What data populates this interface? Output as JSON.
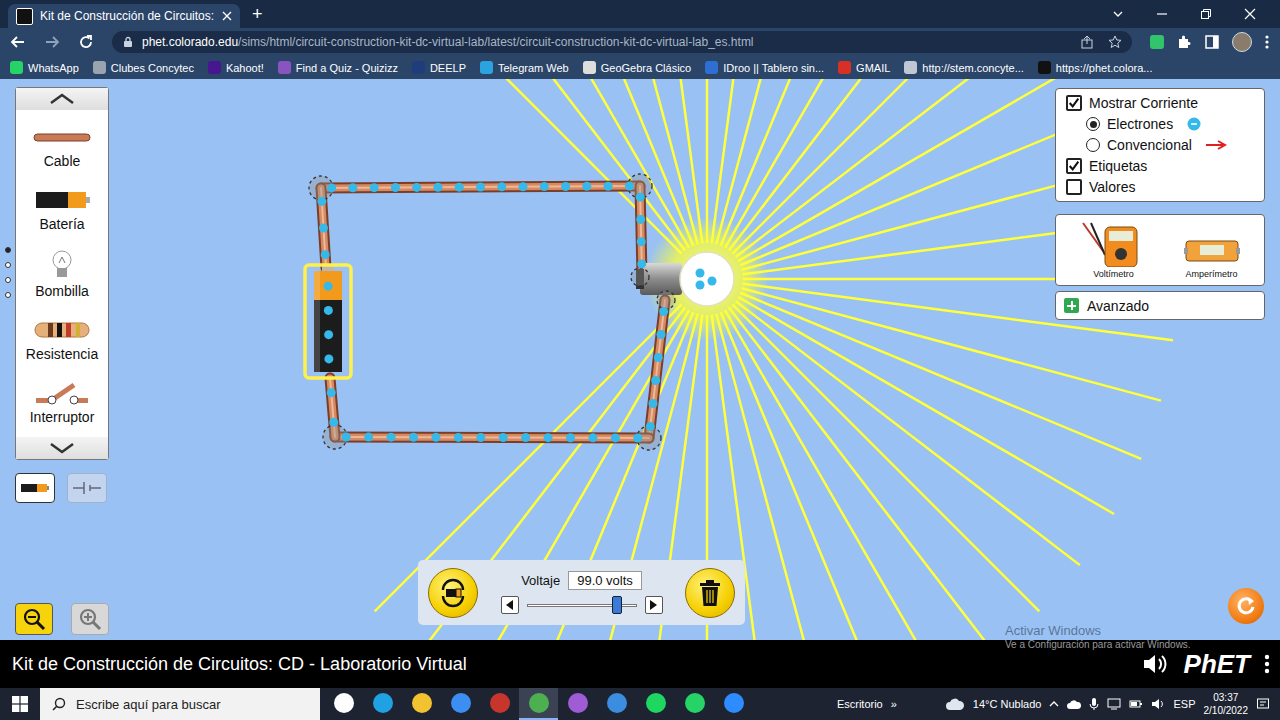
{
  "browser": {
    "tabs": [
      {
        "label": "Kit de Construcción de Circuitos:",
        "selected": true
      }
    ],
    "new_tab": "+",
    "url_host": "phet.colorado.edu",
    "url_path": "/sims/html/circuit-construction-kit-dc-virtual-lab/latest/circuit-construction-kit-dc-virtual-lab_es.html",
    "bookmarks": [
      "WhatsApp",
      "Clubes Concytec",
      "Kahoot!",
      "Find a Quiz - Quizizz",
      "DEELP",
      "Telegram Web",
      "GeoGebra Clásico",
      "IDroo || Tablero sin...",
      "GMAIL",
      "http://stem.concyte...",
      "https://phet.colora..."
    ]
  },
  "sim": {
    "palette": {
      "items": [
        {
          "label": "Cable",
          "kind": "wire"
        },
        {
          "label": "Batería",
          "kind": "battery"
        },
        {
          "label": "Bombilla",
          "kind": "bulb"
        },
        {
          "label": "Resistencia",
          "kind": "resistor"
        },
        {
          "label": "Interruptor",
          "kind": "switch"
        }
      ],
      "pages": [
        {
          "selected": true
        },
        {
          "selected": false
        },
        {
          "selected": false
        },
        {
          "selected": false
        }
      ]
    },
    "view_toggle": [
      {
        "kind": "realistic",
        "selected": true
      },
      {
        "kind": "schematic",
        "selected": false
      }
    ],
    "zoom": [
      {
        "kind": "out",
        "disabled": false
      },
      {
        "kind": "in",
        "disabled": true
      }
    ],
    "circuit": {
      "battery_selected": true,
      "bulb_lit": true
    },
    "display_options": [
      {
        "kind": "checkbox",
        "label": "Mostrar Corriente",
        "checked": true
      },
      {
        "kind": "radio",
        "label": "Electrones",
        "selected": true
      },
      {
        "kind": "radio",
        "label": "Convencional",
        "selected": false
      },
      {
        "kind": "checkbox",
        "label": "Etiquetas",
        "checked": true
      },
      {
        "kind": "checkbox",
        "label": "Valores",
        "checked": false
      }
    ],
    "meters": [
      {
        "label": "Voltímetro",
        "kind": "voltmeter"
      },
      {
        "label": "Amperímetro",
        "kind": "ammeter"
      }
    ],
    "advanced": {
      "label": "Avanzado",
      "expanded": false
    },
    "battery_editor": {
      "label": "Voltaje",
      "value": "99.0 volts",
      "level": 0.825
    }
  },
  "footer": {
    "title": "Kit de Construcción de Circuitos: CD - Laboratorio Virtual",
    "logo": "PhET"
  },
  "watermark": {
    "title": "Activar Windows",
    "subtitle": "Ve a Configuración para activar Windows."
  },
  "taskbar": {
    "search_placeholder": "Escribe aquí para buscar",
    "apps": [
      {
        "active": false
      },
      {
        "active": false
      },
      {
        "active": false
      },
      {
        "active": false
      },
      {
        "active": false
      },
      {
        "active": true
      },
      {
        "active": false
      },
      {
        "active": false
      },
      {
        "active": false
      },
      {
        "active": false
      },
      {
        "active": false
      }
    ],
    "desktop": "Escritorio",
    "desktop_chevron": "»",
    "weather": "14°C Nublado",
    "language": "ESP",
    "time": "03:37",
    "date": "2/10/2022"
  }
}
